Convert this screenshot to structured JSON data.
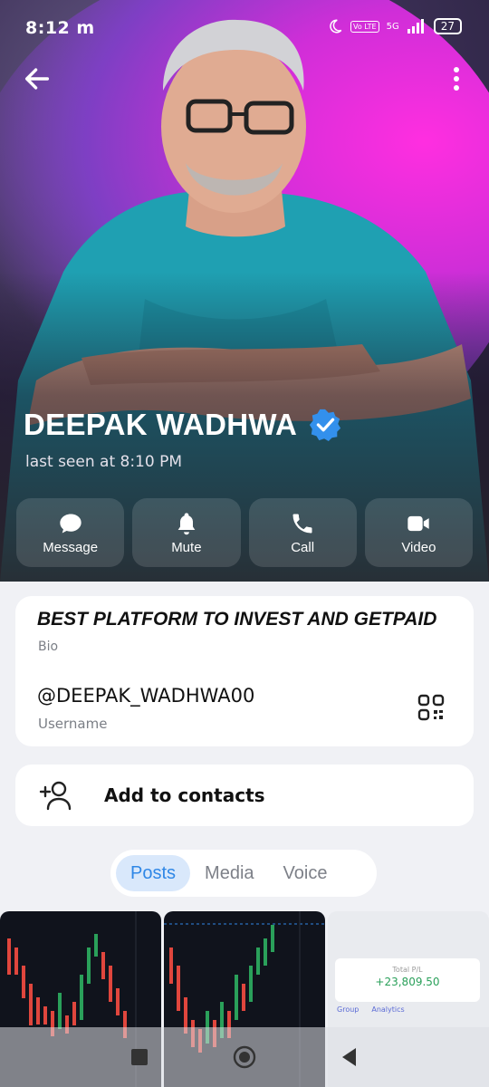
{
  "status": {
    "time": "8:12 m",
    "network": "5G",
    "volte": "Vo LTE",
    "battery": "27"
  },
  "profile": {
    "name": "DEEPAK WADHWA",
    "last_seen": "last seen at 8:10 PM",
    "verified": true
  },
  "actions": [
    {
      "label": "Message",
      "icon": "chat-bubble-icon"
    },
    {
      "label": "Mute",
      "icon": "bell-icon"
    },
    {
      "label": "Call",
      "icon": "phone-icon"
    },
    {
      "label": "Video",
      "icon": "video-camera-icon"
    }
  ],
  "info": {
    "bio": "BEST PLATFORM TO INVEST AND GETPAID",
    "bio_label": "Bio",
    "username": "@DEEPAK_WADHWA00",
    "username_label": "Username"
  },
  "contact": {
    "label": "Add to contacts"
  },
  "tabs": [
    {
      "label": "Posts",
      "active": true
    },
    {
      "label": "Media",
      "active": false
    },
    {
      "label": "Voice",
      "active": false
    }
  ],
  "thumb3": {
    "pnl_label": "Total P/L",
    "pnl_value": "+23,809.50",
    "tab_group": "Group",
    "tab_analytics": "Analytics"
  },
  "colors": {
    "accent": "#2f87e6",
    "verified": "#3390ec",
    "hero_magenta": "#e22fe0"
  }
}
